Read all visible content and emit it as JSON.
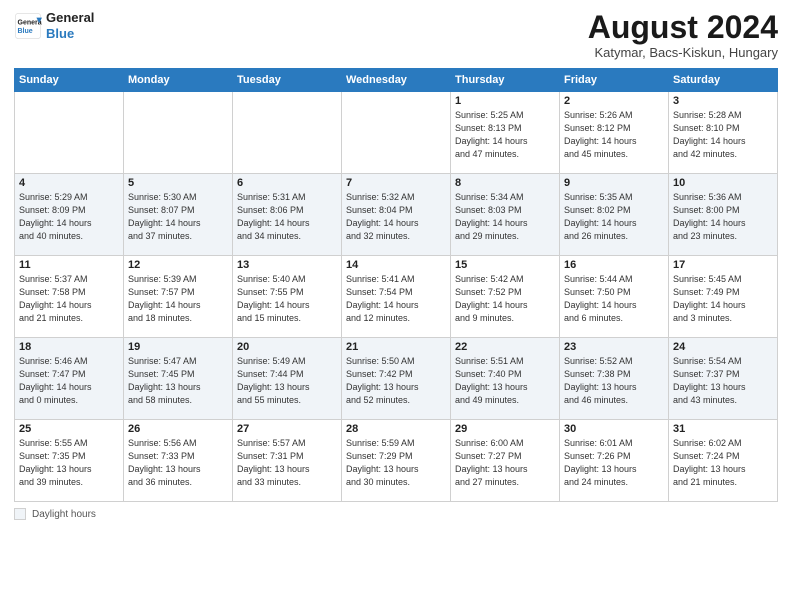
{
  "logo": {
    "text_general": "General",
    "text_blue": "Blue"
  },
  "header": {
    "month_year": "August 2024",
    "location": "Katymar, Bacs-Kiskun, Hungary"
  },
  "days_of_week": [
    "Sunday",
    "Monday",
    "Tuesday",
    "Wednesday",
    "Thursday",
    "Friday",
    "Saturday"
  ],
  "footer": {
    "note_label": "Daylight hours"
  },
  "weeks": [
    {
      "days": [
        {
          "num": "",
          "info": ""
        },
        {
          "num": "",
          "info": ""
        },
        {
          "num": "",
          "info": ""
        },
        {
          "num": "",
          "info": ""
        },
        {
          "num": "1",
          "info": "Sunrise: 5:25 AM\nSunset: 8:13 PM\nDaylight: 14 hours\nand 47 minutes."
        },
        {
          "num": "2",
          "info": "Sunrise: 5:26 AM\nSunset: 8:12 PM\nDaylight: 14 hours\nand 45 minutes."
        },
        {
          "num": "3",
          "info": "Sunrise: 5:28 AM\nSunset: 8:10 PM\nDaylight: 14 hours\nand 42 minutes."
        }
      ]
    },
    {
      "days": [
        {
          "num": "4",
          "info": "Sunrise: 5:29 AM\nSunset: 8:09 PM\nDaylight: 14 hours\nand 40 minutes."
        },
        {
          "num": "5",
          "info": "Sunrise: 5:30 AM\nSunset: 8:07 PM\nDaylight: 14 hours\nand 37 minutes."
        },
        {
          "num": "6",
          "info": "Sunrise: 5:31 AM\nSunset: 8:06 PM\nDaylight: 14 hours\nand 34 minutes."
        },
        {
          "num": "7",
          "info": "Sunrise: 5:32 AM\nSunset: 8:04 PM\nDaylight: 14 hours\nand 32 minutes."
        },
        {
          "num": "8",
          "info": "Sunrise: 5:34 AM\nSunset: 8:03 PM\nDaylight: 14 hours\nand 29 minutes."
        },
        {
          "num": "9",
          "info": "Sunrise: 5:35 AM\nSunset: 8:02 PM\nDaylight: 14 hours\nand 26 minutes."
        },
        {
          "num": "10",
          "info": "Sunrise: 5:36 AM\nSunset: 8:00 PM\nDaylight: 14 hours\nand 23 minutes."
        }
      ]
    },
    {
      "days": [
        {
          "num": "11",
          "info": "Sunrise: 5:37 AM\nSunset: 7:58 PM\nDaylight: 14 hours\nand 21 minutes."
        },
        {
          "num": "12",
          "info": "Sunrise: 5:39 AM\nSunset: 7:57 PM\nDaylight: 14 hours\nand 18 minutes."
        },
        {
          "num": "13",
          "info": "Sunrise: 5:40 AM\nSunset: 7:55 PM\nDaylight: 14 hours\nand 15 minutes."
        },
        {
          "num": "14",
          "info": "Sunrise: 5:41 AM\nSunset: 7:54 PM\nDaylight: 14 hours\nand 12 minutes."
        },
        {
          "num": "15",
          "info": "Sunrise: 5:42 AM\nSunset: 7:52 PM\nDaylight: 14 hours\nand 9 minutes."
        },
        {
          "num": "16",
          "info": "Sunrise: 5:44 AM\nSunset: 7:50 PM\nDaylight: 14 hours\nand 6 minutes."
        },
        {
          "num": "17",
          "info": "Sunrise: 5:45 AM\nSunset: 7:49 PM\nDaylight: 14 hours\nand 3 minutes."
        }
      ]
    },
    {
      "days": [
        {
          "num": "18",
          "info": "Sunrise: 5:46 AM\nSunset: 7:47 PM\nDaylight: 14 hours\nand 0 minutes."
        },
        {
          "num": "19",
          "info": "Sunrise: 5:47 AM\nSunset: 7:45 PM\nDaylight: 13 hours\nand 58 minutes."
        },
        {
          "num": "20",
          "info": "Sunrise: 5:49 AM\nSunset: 7:44 PM\nDaylight: 13 hours\nand 55 minutes."
        },
        {
          "num": "21",
          "info": "Sunrise: 5:50 AM\nSunset: 7:42 PM\nDaylight: 13 hours\nand 52 minutes."
        },
        {
          "num": "22",
          "info": "Sunrise: 5:51 AM\nSunset: 7:40 PM\nDaylight: 13 hours\nand 49 minutes."
        },
        {
          "num": "23",
          "info": "Sunrise: 5:52 AM\nSunset: 7:38 PM\nDaylight: 13 hours\nand 46 minutes."
        },
        {
          "num": "24",
          "info": "Sunrise: 5:54 AM\nSunset: 7:37 PM\nDaylight: 13 hours\nand 43 minutes."
        }
      ]
    },
    {
      "days": [
        {
          "num": "25",
          "info": "Sunrise: 5:55 AM\nSunset: 7:35 PM\nDaylight: 13 hours\nand 39 minutes."
        },
        {
          "num": "26",
          "info": "Sunrise: 5:56 AM\nSunset: 7:33 PM\nDaylight: 13 hours\nand 36 minutes."
        },
        {
          "num": "27",
          "info": "Sunrise: 5:57 AM\nSunset: 7:31 PM\nDaylight: 13 hours\nand 33 minutes."
        },
        {
          "num": "28",
          "info": "Sunrise: 5:59 AM\nSunset: 7:29 PM\nDaylight: 13 hours\nand 30 minutes."
        },
        {
          "num": "29",
          "info": "Sunrise: 6:00 AM\nSunset: 7:27 PM\nDaylight: 13 hours\nand 27 minutes."
        },
        {
          "num": "30",
          "info": "Sunrise: 6:01 AM\nSunset: 7:26 PM\nDaylight: 13 hours\nand 24 minutes."
        },
        {
          "num": "31",
          "info": "Sunrise: 6:02 AM\nSunset: 7:24 PM\nDaylight: 13 hours\nand 21 minutes."
        }
      ]
    }
  ]
}
